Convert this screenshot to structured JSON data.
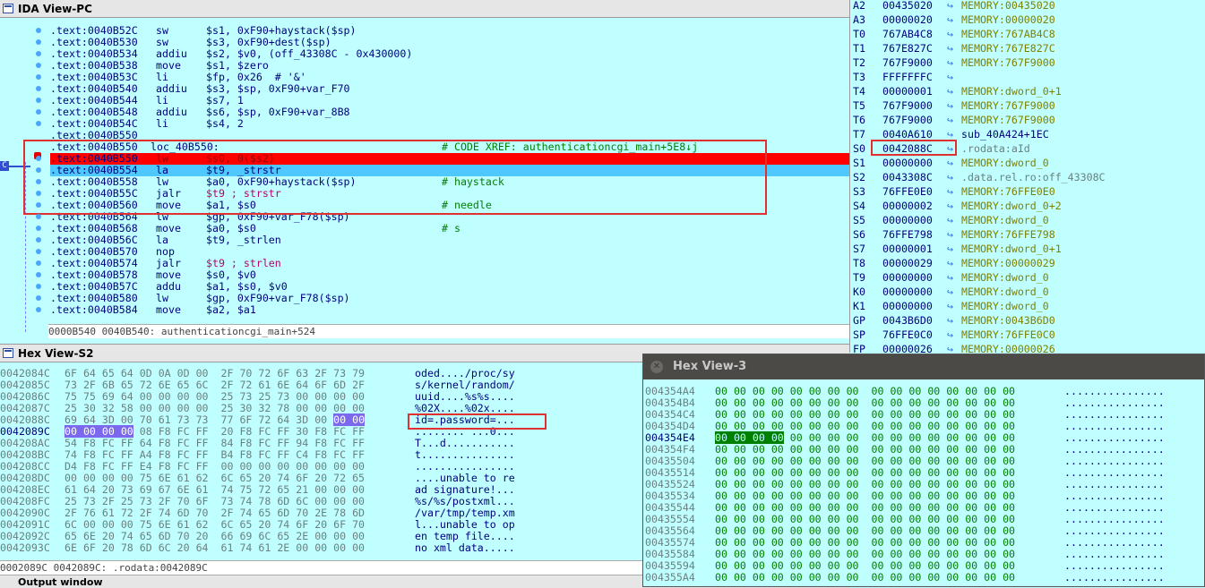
{
  "ida_view": {
    "title": "IDA View-PC",
    "lines": [
      {
        "addr": ".text:0040B52C",
        "mnem": "sw",
        "ops": "$s1, 0xF90+haystack($sp)",
        "comment": ""
      },
      {
        "addr": ".text:0040B530",
        "mnem": "sw",
        "ops": "$s3, 0xF90+dest($sp)",
        "comment": ""
      },
      {
        "addr": ".text:0040B534",
        "mnem": "addiu",
        "ops": "$s2, $v0, (off_43308C - 0x430000)",
        "comment": ""
      },
      {
        "addr": ".text:0040B538",
        "mnem": "move",
        "ops": "$s1, $zero",
        "comment": ""
      },
      {
        "addr": ".text:0040B53C",
        "mnem": "li",
        "ops": "$fp, 0x26  # '&'",
        "comment": ""
      },
      {
        "addr": ".text:0040B540",
        "mnem": "addiu",
        "ops": "$s3, $sp, 0xF90+var_F70",
        "comment": ""
      },
      {
        "addr": ".text:0040B544",
        "mnem": "li",
        "ops": "$s7, 1",
        "comment": ""
      },
      {
        "addr": ".text:0040B548",
        "mnem": "addiu",
        "ops": "$s6, $sp, 0xF90+var_8B8",
        "comment": ""
      },
      {
        "addr": ".text:0040B54C",
        "mnem": "li",
        "ops": "$s4, 2",
        "comment": ""
      },
      {
        "addr": ".text:0040B550",
        "mnem": "",
        "ops": "",
        "comment": ""
      },
      {
        "addr": ".text:0040B550",
        "mnem": "loc_40B550:",
        "ops": "",
        "comment": "# CODE XREF: authenticationcgi_main+5E8↓j"
      },
      {
        "addr": ".text:0040B550",
        "mnem": "lw",
        "ops": "$s0, 0($s2)",
        "comment": ""
      },
      {
        "addr": ".text:0040B554",
        "mnem": "la",
        "ops": "$t9, _strstr",
        "comment": ""
      },
      {
        "addr": ".text:0040B558",
        "mnem": "lw",
        "ops": "$a0, 0xF90+haystack($sp)",
        "comment": "# haystack"
      },
      {
        "addr": ".text:0040B55C",
        "mnem": "jalr",
        "ops": "$t9 ; strstr",
        "comment": ""
      },
      {
        "addr": ".text:0040B560",
        "mnem": "move",
        "ops": "$a1, $s0",
        "comment": "# needle"
      },
      {
        "addr": ".text:0040B564",
        "mnem": "lw",
        "ops": "$gp, 0xF90+var_F78($sp)",
        "comment": ""
      },
      {
        "addr": ".text:0040B568",
        "mnem": "move",
        "ops": "$a0, $s0",
        "comment": "# s"
      },
      {
        "addr": ".text:0040B56C",
        "mnem": "la",
        "ops": "$t9, _strlen",
        "comment": ""
      },
      {
        "addr": ".text:0040B570",
        "mnem": "nop",
        "ops": "",
        "comment": ""
      },
      {
        "addr": ".text:0040B574",
        "mnem": "jalr",
        "ops": "$t9 ; strlen",
        "comment": ""
      },
      {
        "addr": ".text:0040B578",
        "mnem": "move",
        "ops": "$s0, $v0",
        "comment": ""
      },
      {
        "addr": ".text:0040B57C",
        "mnem": "addu",
        "ops": "$a1, $s0, $v0",
        "comment": ""
      },
      {
        "addr": ".text:0040B580",
        "mnem": "lw",
        "ops": "$gp, 0xF90+var_F78($sp)",
        "comment": ""
      },
      {
        "addr": ".text:0040B584",
        "mnem": "move",
        "ops": "$a2, $a1",
        "comment": ""
      }
    ],
    "status": "0000B540 0040B540: authenticationcgi_main+524",
    "pc_marker": "C"
  },
  "registers": [
    {
      "name": "A2",
      "value": "00435020",
      "ref": "MEMORY:00435020"
    },
    {
      "name": "A3",
      "value": "00000020",
      "ref": "MEMORY:00000020"
    },
    {
      "name": "T0",
      "value": "767AB4C8",
      "ref": "MEMORY:767AB4C8"
    },
    {
      "name": "T1",
      "value": "767E827C",
      "ref": "MEMORY:767E827C"
    },
    {
      "name": "T2",
      "value": "767F9000",
      "ref": "MEMORY:767F9000"
    },
    {
      "name": "T3",
      "value": "FFFFFFFC",
      "ref": ""
    },
    {
      "name": "T4",
      "value": "00000001",
      "ref": "MEMORY:dword_0+1"
    },
    {
      "name": "T5",
      "value": "767F9000",
      "ref": "MEMORY:767F9000"
    },
    {
      "name": "T6",
      "value": "767F9000",
      "ref": "MEMORY:767F9000"
    },
    {
      "name": "T7",
      "value": "0040A610",
      "ref": "sub_40A424+1EC"
    },
    {
      "name": "S0",
      "value": "0042088C",
      "ref": ".rodata:aId"
    },
    {
      "name": "S1",
      "value": "00000000",
      "ref": "MEMORY:dword_0"
    },
    {
      "name": "S2",
      "value": "0043308C",
      "ref": ".data.rel.ro:off_43308C"
    },
    {
      "name": "S3",
      "value": "76FFE0E0",
      "ref": "MEMORY:76FFE0E0"
    },
    {
      "name": "S4",
      "value": "00000002",
      "ref": "MEMORY:dword_0+2"
    },
    {
      "name": "S5",
      "value": "00000000",
      "ref": "MEMORY:dword_0"
    },
    {
      "name": "S6",
      "value": "76FFE798",
      "ref": "MEMORY:76FFE798"
    },
    {
      "name": "S7",
      "value": "00000001",
      "ref": "MEMORY:dword_0+1"
    },
    {
      "name": "T8",
      "value": "00000029",
      "ref": "MEMORY:00000029"
    },
    {
      "name": "T9",
      "value": "00000000",
      "ref": "MEMORY:dword_0"
    },
    {
      "name": "K0",
      "value": "00000000",
      "ref": "MEMORY:dword_0"
    },
    {
      "name": "K1",
      "value": "00000000",
      "ref": "MEMORY:dword_0"
    },
    {
      "name": "GP",
      "value": "0043B6D0",
      "ref": "MEMORY:0043B6D0"
    },
    {
      "name": "SP",
      "value": "76FFE0C0",
      "ref": "MEMORY:76FFE0C0"
    },
    {
      "name": "FP",
      "value": "00000026",
      "ref": "MEMORY:00000026"
    }
  ],
  "hex_view_s2": {
    "title": "Hex View-S2",
    "rows": [
      {
        "addr": "0042084C",
        "bytes": "6F 64 65 64 0D 0A 0D 00  2F 70 72 6F 63 2F 73 79",
        "ascii": "oded..../proc/sy"
      },
      {
        "addr": "0042085C",
        "bytes": "73 2F 6B 65 72 6E 65 6C  2F 72 61 6E 64 6F 6D 2F",
        "ascii": "s/kernel/random/"
      },
      {
        "addr": "0042086C",
        "bytes": "75 75 69 64 00 00 00 00  25 73 25 73 00 00 00 00",
        "ascii": "uuid....%s%s...."
      },
      {
        "addr": "0042087C",
        "bytes": "25 30 32 58 00 00 00 00  25 30 32 78 00 00 00 00",
        "ascii": "%02X....%02x...."
      },
      {
        "addr": "0042088C",
        "bytes": "69 64 3D 00 70 61 73 73  77 6F 72 64 3D 00 00 00",
        "ascii": "id=.password=..."
      },
      {
        "addr": "0042089C",
        "bytes": "00 00 00 00 08 F8 FC FF  20 F8 FC FF 30 F8 FC FF",
        "ascii": "........ ...0..."
      },
      {
        "addr": "004208AC",
        "bytes": "54 F8 FC FF 64 F8 FC FF  84 F8 FC FF 94 F8 FC FF",
        "ascii": "T...d..........."
      },
      {
        "addr": "004208BC",
        "bytes": "74 F8 FC FF A4 F8 FC FF  B4 F8 FC FF C4 F8 FC FF",
        "ascii": "t..............."
      },
      {
        "addr": "004208CC",
        "bytes": "D4 F8 FC FF E4 F8 FC FF  00 00 00 00 00 00 00 00",
        "ascii": "................"
      },
      {
        "addr": "004208DC",
        "bytes": "00 00 00 00 75 6E 61 62  6C 65 20 74 6F 20 72 65",
        "ascii": "....unable to re"
      },
      {
        "addr": "004208EC",
        "bytes": "61 64 20 73 69 67 6E 61  74 75 72 65 21 00 00 00",
        "ascii": "ad signature!..."
      },
      {
        "addr": "004208FC",
        "bytes": "25 73 2F 25 73 2F 70 6F  73 74 78 6D 6C 00 00 00",
        "ascii": "%s/%s/postxml..."
      },
      {
        "addr": "0042090C",
        "bytes": "2F 76 61 72 2F 74 6D 70  2F 74 65 6D 70 2E 78 6D",
        "ascii": "/var/tmp/temp.xm"
      },
      {
        "addr": "0042091C",
        "bytes": "6C 00 00 00 75 6E 61 62  6C 65 20 74 6F 20 6F 70",
        "ascii": "l...unable to op"
      },
      {
        "addr": "0042092C",
        "bytes": "65 6E 20 74 65 6D 70 20  66 69 6C 65 2E 00 00 00",
        "ascii": "en temp file...."
      },
      {
        "addr": "0042093C",
        "bytes": "6E 6F 20 78 6D 6C 20 64  61 74 61 2E 00 00 00 00",
        "ascii": "no xml data....."
      }
    ],
    "status": "0002089C 0042089C: .rodata:0042089C",
    "bottom_tab": "Output window"
  },
  "hex_view_3": {
    "title": "Hex View-3",
    "rows": [
      {
        "addr": "004354A4",
        "bytes": "00 00 00 00 00 00 00 00  00 00 00 00 00 00 00 00",
        "ascii": "................"
      },
      {
        "addr": "004354B4",
        "bytes": "00 00 00 00 00 00 00 00  00 00 00 00 00 00 00 00",
        "ascii": "................"
      },
      {
        "addr": "004354C4",
        "bytes": "00 00 00 00 00 00 00 00  00 00 00 00 00 00 00 00",
        "ascii": "................"
      },
      {
        "addr": "004354D4",
        "bytes": "00 00 00 00 00 00 00 00  00 00 00 00 00 00 00 00",
        "ascii": "................"
      },
      {
        "addr": "004354E4",
        "bytes": "00 00 00 00 00 00 00 00  00 00 00 00 00 00 00 00",
        "ascii": "................"
      },
      {
        "addr": "004354F4",
        "bytes": "00 00 00 00 00 00 00 00  00 00 00 00 00 00 00 00",
        "ascii": "................"
      },
      {
        "addr": "00435504",
        "bytes": "00 00 00 00 00 00 00 00  00 00 00 00 00 00 00 00",
        "ascii": "................"
      },
      {
        "addr": "00435514",
        "bytes": "00 00 00 00 00 00 00 00  00 00 00 00 00 00 00 00",
        "ascii": "................"
      },
      {
        "addr": "00435524",
        "bytes": "00 00 00 00 00 00 00 00  00 00 00 00 00 00 00 00",
        "ascii": "................"
      },
      {
        "addr": "00435534",
        "bytes": "00 00 00 00 00 00 00 00  00 00 00 00 00 00 00 00",
        "ascii": "................"
      },
      {
        "addr": "00435544",
        "bytes": "00 00 00 00 00 00 00 00  00 00 00 00 00 00 00 00",
        "ascii": "................"
      },
      {
        "addr": "00435554",
        "bytes": "00 00 00 00 00 00 00 00  00 00 00 00 00 00 00 00",
        "ascii": "................"
      },
      {
        "addr": "00435564",
        "bytes": "00 00 00 00 00 00 00 00  00 00 00 00 00 00 00 00",
        "ascii": "................"
      },
      {
        "addr": "00435574",
        "bytes": "00 00 00 00 00 00 00 00  00 00 00 00 00 00 00 00",
        "ascii": "................"
      },
      {
        "addr": "00435584",
        "bytes": "00 00 00 00 00 00 00 00  00 00 00 00 00 00 00 00",
        "ascii": "................"
      },
      {
        "addr": "00435594",
        "bytes": "00 00 00 00 00 00 00 00  00 00 00 00 00 00 00 00",
        "ascii": "................"
      },
      {
        "addr": "004355A4",
        "bytes": "00 00 00 00 00 00 00 00  00 00 00 00 00 00 00 00",
        "ascii": "................"
      }
    ]
  },
  "colors": {
    "bg": "#c0ffff",
    "highlight_red": "#ff0000",
    "highlight_blue": "#4fc8ff",
    "annotation_box": "#e03030",
    "olive": "#808000"
  }
}
